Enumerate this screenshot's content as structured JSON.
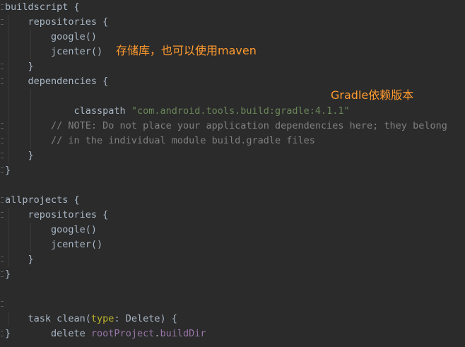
{
  "editor": {
    "lines": [
      "buildscript {",
      "    repositories {",
      "        google()",
      "        jcenter()",
      "    }",
      "    dependencies {",
      "        classpath ",
      "",
      "        // NOTE: Do not place your application dependencies here; they belong",
      "        // in the individual module build.gradle files",
      "    }",
      "}",
      "",
      "allprojects {",
      "    repositories {",
      "        google()",
      "        jcenter()",
      "    }",
      "}",
      "",
      "task clean(",
      "    delete "
    ],
    "classpath_string": "\"com.android.tools.build:gradle:4.1.1\"",
    "task_param": "type",
    "task_rest": ": Delete) {",
    "delete_target": "rootProject",
    "delete_dot": ".",
    "delete_prop": "buildDir",
    "last_brace": "}"
  },
  "annotations": {
    "repo_note": "存储库，也可以使用maven",
    "gradle_note": "Gradle依赖版本"
  },
  "colors": {
    "background": "#2b2b2b",
    "default_text": "#a9b7c6",
    "string": "#6a8759",
    "comment": "#808080",
    "named_param": "#bbb529",
    "property": "#9876aa",
    "annotation": "#ff9a2e"
  }
}
